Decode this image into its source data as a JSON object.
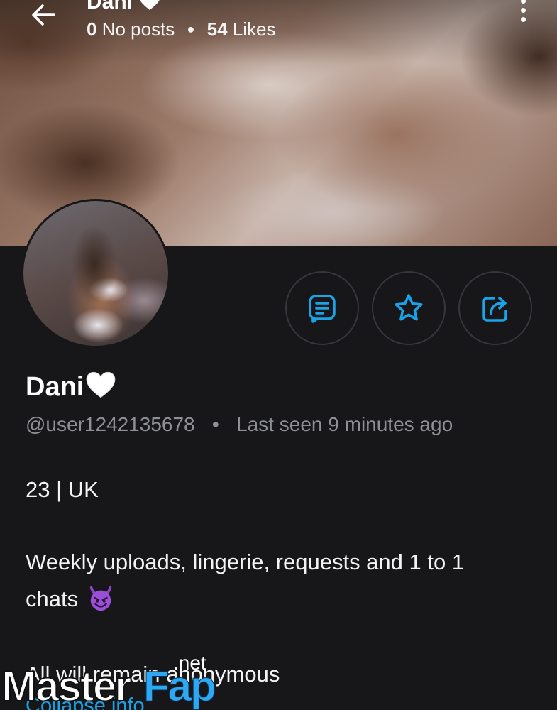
{
  "header": {
    "title": "Dani",
    "posts_count": "0",
    "posts_label": "No posts",
    "likes_count": "54",
    "likes_label": "Likes"
  },
  "actions": {
    "message_icon": "message-icon",
    "favorite_icon": "star-icon",
    "share_icon": "share-icon",
    "accent_color": "#1aa3e8"
  },
  "profile": {
    "name": "Dani",
    "handle": "@user1242135678",
    "last_seen": "Last seen 9 minutes ago"
  },
  "bio": {
    "line1": "23 | UK",
    "line2": "Weekly uploads, lingerie, requests and 1 to 1",
    "line3": "chats",
    "line4": "All will remain anonymous",
    "collapse_label": "Collapse info"
  },
  "watermark": {
    "brand_part1": "Master",
    "brand_part2": "Fap",
    "brand_suffix": ".net"
  }
}
